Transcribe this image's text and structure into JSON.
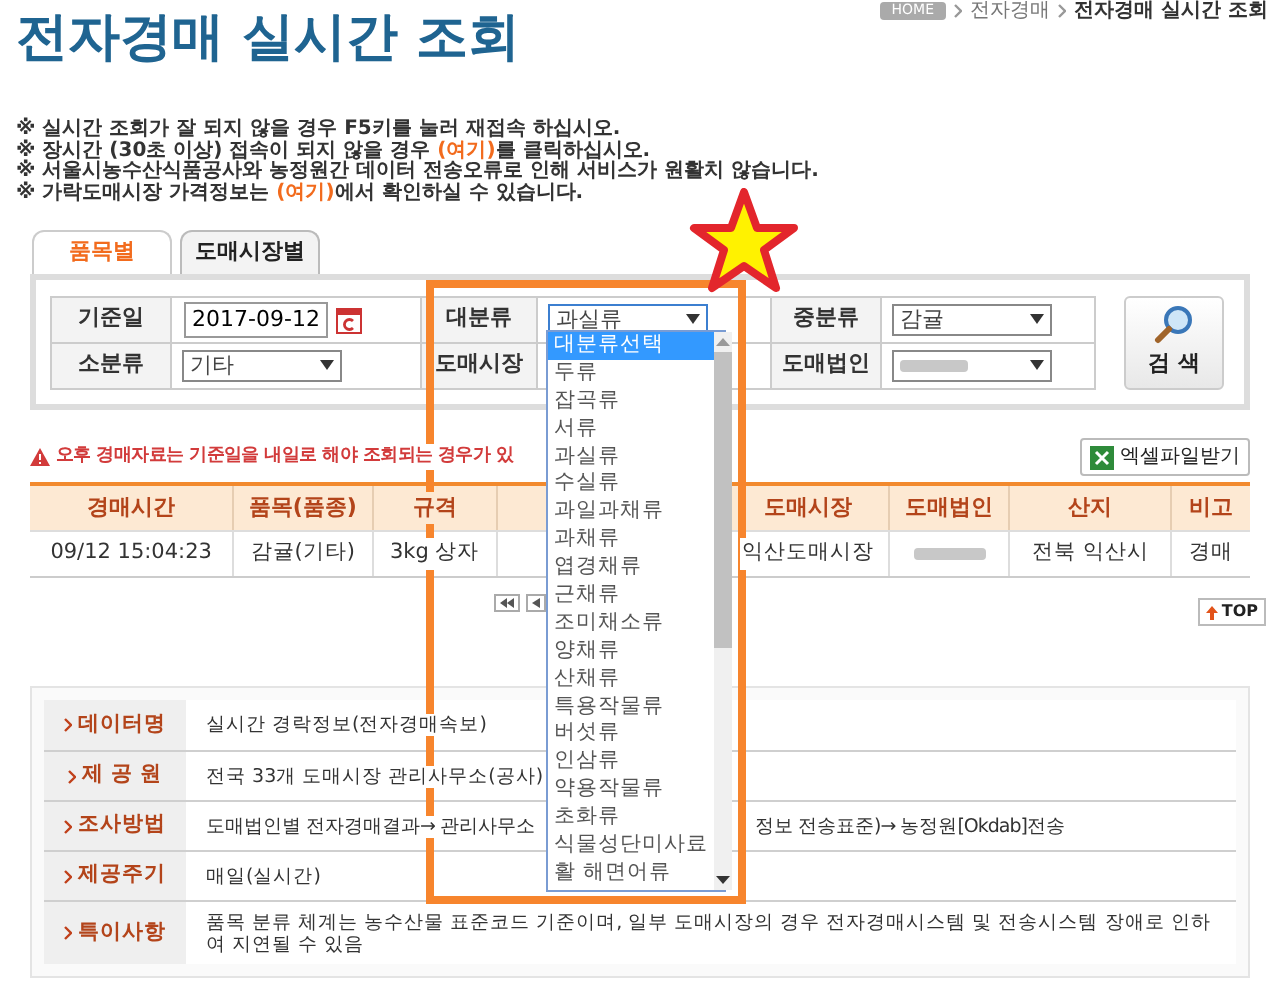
{
  "page_title": "전자경매 실시간 조회",
  "breadcrumb": [
    "HOME",
    "전자경매",
    "전자경매 실시간 조회"
  ],
  "notices": [
    {
      "parts": [
        {
          "kind": "text",
          "text": "※ 실시간 조회가 잘 되지 않을 경우 F5키를 눌러 재접속 하십시오."
        }
      ]
    },
    {
      "parts": [
        {
          "kind": "text",
          "text": "※ 장시간 (30초 이상) 접속이 되지 않을 경우 "
        },
        {
          "kind": "link",
          "text": "(여기)"
        },
        {
          "kind": "text",
          "text": "를 클릭하십시오."
        }
      ]
    },
    {
      "parts": [
        {
          "kind": "text",
          "text": "※ 서울시농수산식품공사와 농정원간 데이터 전송오류로 인해 서비스가 원활치 않습니다."
        }
      ]
    },
    {
      "parts": [
        {
          "kind": "text",
          "text": "※ 가락도매시장 가격정보는 "
        },
        {
          "kind": "link",
          "text": "(여기)"
        },
        {
          "kind": "text",
          "text": "에서 확인하실 수 있습니다."
        }
      ]
    }
  ],
  "tabs": [
    {
      "label": "품목별",
      "selected": true
    },
    {
      "label": "도매시장별",
      "selected": false
    }
  ],
  "search_form": {
    "fields": [
      {
        "label": "기준일",
        "kind": "date",
        "value": "2017-09-12"
      },
      {
        "label": "대분류",
        "kind": "select",
        "value": "과실류",
        "expanded": true
      },
      {
        "label": "중분류",
        "kind": "select",
        "value": "감귤",
        "expanded": false
      },
      {
        "label": "소분류",
        "kind": "select",
        "value": "기타",
        "expanded": false
      },
      {
        "label": "도매시장",
        "kind": "covered"
      },
      {
        "label": "도매법인",
        "kind": "blurred"
      }
    ],
    "search_button": "검 색"
  },
  "dropdown_options": [
    {
      "label": "대분류선택",
      "selected": true
    },
    {
      "label": "두류",
      "selected": false
    },
    {
      "label": "잡곡류",
      "selected": false
    },
    {
      "label": "서류",
      "selected": false
    },
    {
      "label": "과실류",
      "selected": false
    },
    {
      "label": "수실류",
      "selected": false
    },
    {
      "label": "과일과채류",
      "selected": false
    },
    {
      "label": "과채류",
      "selected": false
    },
    {
      "label": "엽경채류",
      "selected": false
    },
    {
      "label": "근채류",
      "selected": false
    },
    {
      "label": "조미채소류",
      "selected": false
    },
    {
      "label": "양채류",
      "selected": false
    },
    {
      "label": "산채류",
      "selected": false
    },
    {
      "label": "특용작물류",
      "selected": false
    },
    {
      "label": "버섯류",
      "selected": false
    },
    {
      "label": "인삼류",
      "selected": false
    },
    {
      "label": "약용작물류",
      "selected": false
    },
    {
      "label": "초화류",
      "selected": false
    },
    {
      "label": "식물성단미사료",
      "selected": false
    },
    {
      "label": "활 해면어류",
      "selected": false
    }
  ],
  "warning": "오후 경매자료는 기준일을 내일로 해야 조회되는 경우가 있",
  "excel_button": "엑셀파일받기",
  "results": {
    "columns": [
      {
        "kind": "text",
        "label": "경매시간"
      },
      {
        "kind": "text",
        "label": "품목(품종)"
      },
      {
        "kind": "text",
        "label": "규격"
      },
      {
        "kind": "covered"
      },
      {
        "kind": "text",
        "label": "도매시장"
      },
      {
        "kind": "text",
        "label": "도매법인"
      },
      {
        "kind": "text",
        "label": "산지"
      },
      {
        "kind": "text",
        "label": "비고"
      }
    ],
    "rows": [
      [
        {
          "kind": "text",
          "text": "09/12 15:04:23"
        },
        {
          "kind": "text",
          "text": "감귤(기타)"
        },
        {
          "kind": "text",
          "text": "3kg 상자"
        },
        {
          "kind": "covered"
        },
        {
          "kind": "text",
          "text": "익산도매시장"
        },
        {
          "kind": "blurred"
        },
        {
          "kind": "text",
          "text": "전북 익산시"
        },
        {
          "kind": "text",
          "text": "경매"
        }
      ]
    ]
  },
  "top_button": "TOP",
  "info": [
    {
      "label": "데이터명",
      "parts": [
        "실시간 경락정보(전자경매속보)"
      ]
    },
    {
      "label": "제 공 원",
      "parts": [
        "전국 33개 도매시장 관리사무소(공사)"
      ]
    },
    {
      "label": "조사방법",
      "parts": [
        "도매법인별 전자경매결과→ 관리사무소",
        "정보 전송표준)→ 농정원[Okdab]전송"
      ]
    },
    {
      "label": "제공주기",
      "parts": [
        "매일(실시간)"
      ]
    },
    {
      "label": "특이사항",
      "parts": [
        "품목 분류 체계는 농수산물 표준코드 기준이며, 일부 도매시장의 경우 전자경매시스템 및 전송시스템 장애로 인하여 지연될 수 있음"
      ]
    }
  ]
}
